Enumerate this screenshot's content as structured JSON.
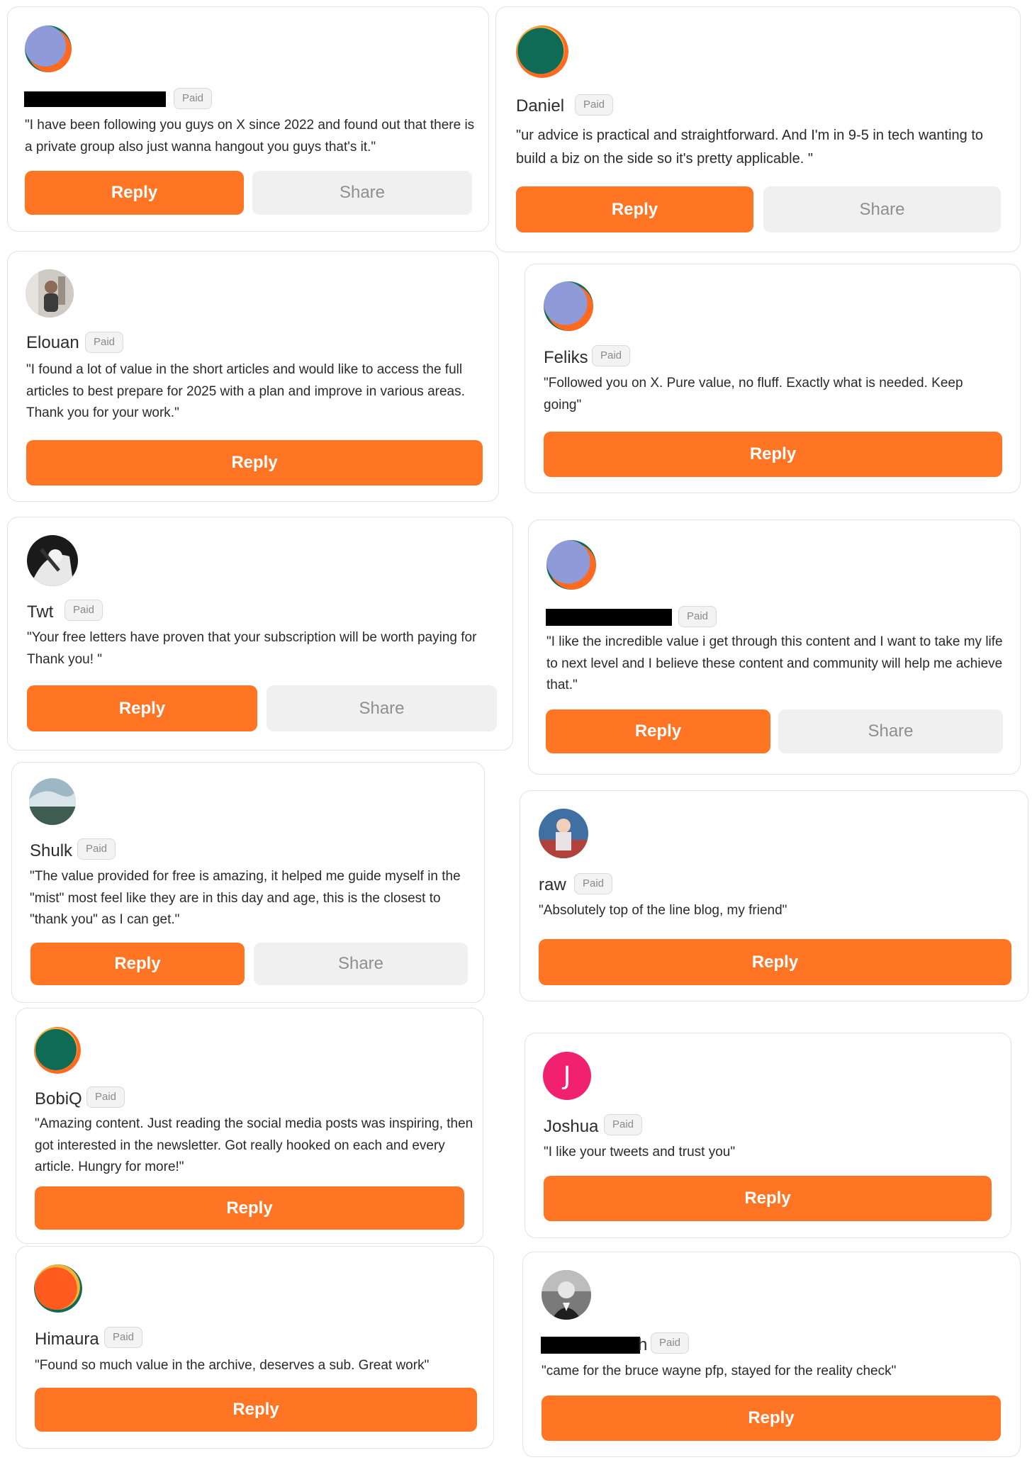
{
  "common": {
    "badge": "Paid",
    "reply": "Reply",
    "share": "Share"
  },
  "colors": {
    "accent": "#ff7524",
    "share_bg": "#f0f0f0",
    "letter_avatar": "#f2216f"
  },
  "comments": [
    {
      "name": "",
      "avatar": "default-avatar",
      "quote": "\"I have been following you guys on X since 2022 and found out that there is a private group also just wanna hangout you guys that's it.\""
    },
    {
      "name": "Daniel",
      "avatar": "default-avatar",
      "quote": "\"ur advice is practical and straightforward. And I'm in 9-5 in tech wanting to build a biz on the side so it's pretty applicable. \""
    },
    {
      "name": "Elouan",
      "avatar": "photo-avatar",
      "quote": "\"I found a lot of value in the short articles and would like to access the full articles to best prepare for 2025 with a plan and improve in various areas. Thank you for your work.\""
    },
    {
      "name": "Feliks",
      "avatar": "default-avatar",
      "quote": "\"Followed you on X. Pure value, no fluff. Exactly what is needed. Keep going\""
    },
    {
      "name": "Twt",
      "avatar": "photo-avatar",
      "quote": "\"Your free letters have proven that your subscription will be worth paying for Thank you! \""
    },
    {
      "name": "",
      "avatar": "default-avatar",
      "quote": "\"I like the incredible value i get through this content and I want to take my life to next level and I believe these content and community will help me achieve that.\""
    },
    {
      "name": "Shulk",
      "avatar": "photo-avatar",
      "quote": "\"The value provided for free is amazing, it helped me guide myself in the \"mist\" most feel like they are in this day and age, this is the closest to \"thank you\" as I can get.\""
    },
    {
      "name": "raw",
      "avatar": "photo-avatar",
      "quote": "\"Absolutely top of the line blog, my friend\""
    },
    {
      "name": "BobiQ",
      "avatar": "default-avatar",
      "quote": "\"Amazing content. Just reading the social media posts was inspiring, then got interested in the newsletter. Got really hooked on each and every article. Hungry for more!\""
    },
    {
      "name": "Joshua",
      "avatar": "letter-avatar",
      "initial": "J",
      "quote": "\"I like your tweets and trust you\""
    },
    {
      "name": "Himaura",
      "avatar": "default-avatar",
      "quote": "\"Found so much value in the archive, deserves a sub. Great work\""
    },
    {
      "name": "h",
      "avatar": "photo-avatar",
      "quote": "\"came for the bruce wayne pfp, stayed for the reality check\""
    }
  ]
}
